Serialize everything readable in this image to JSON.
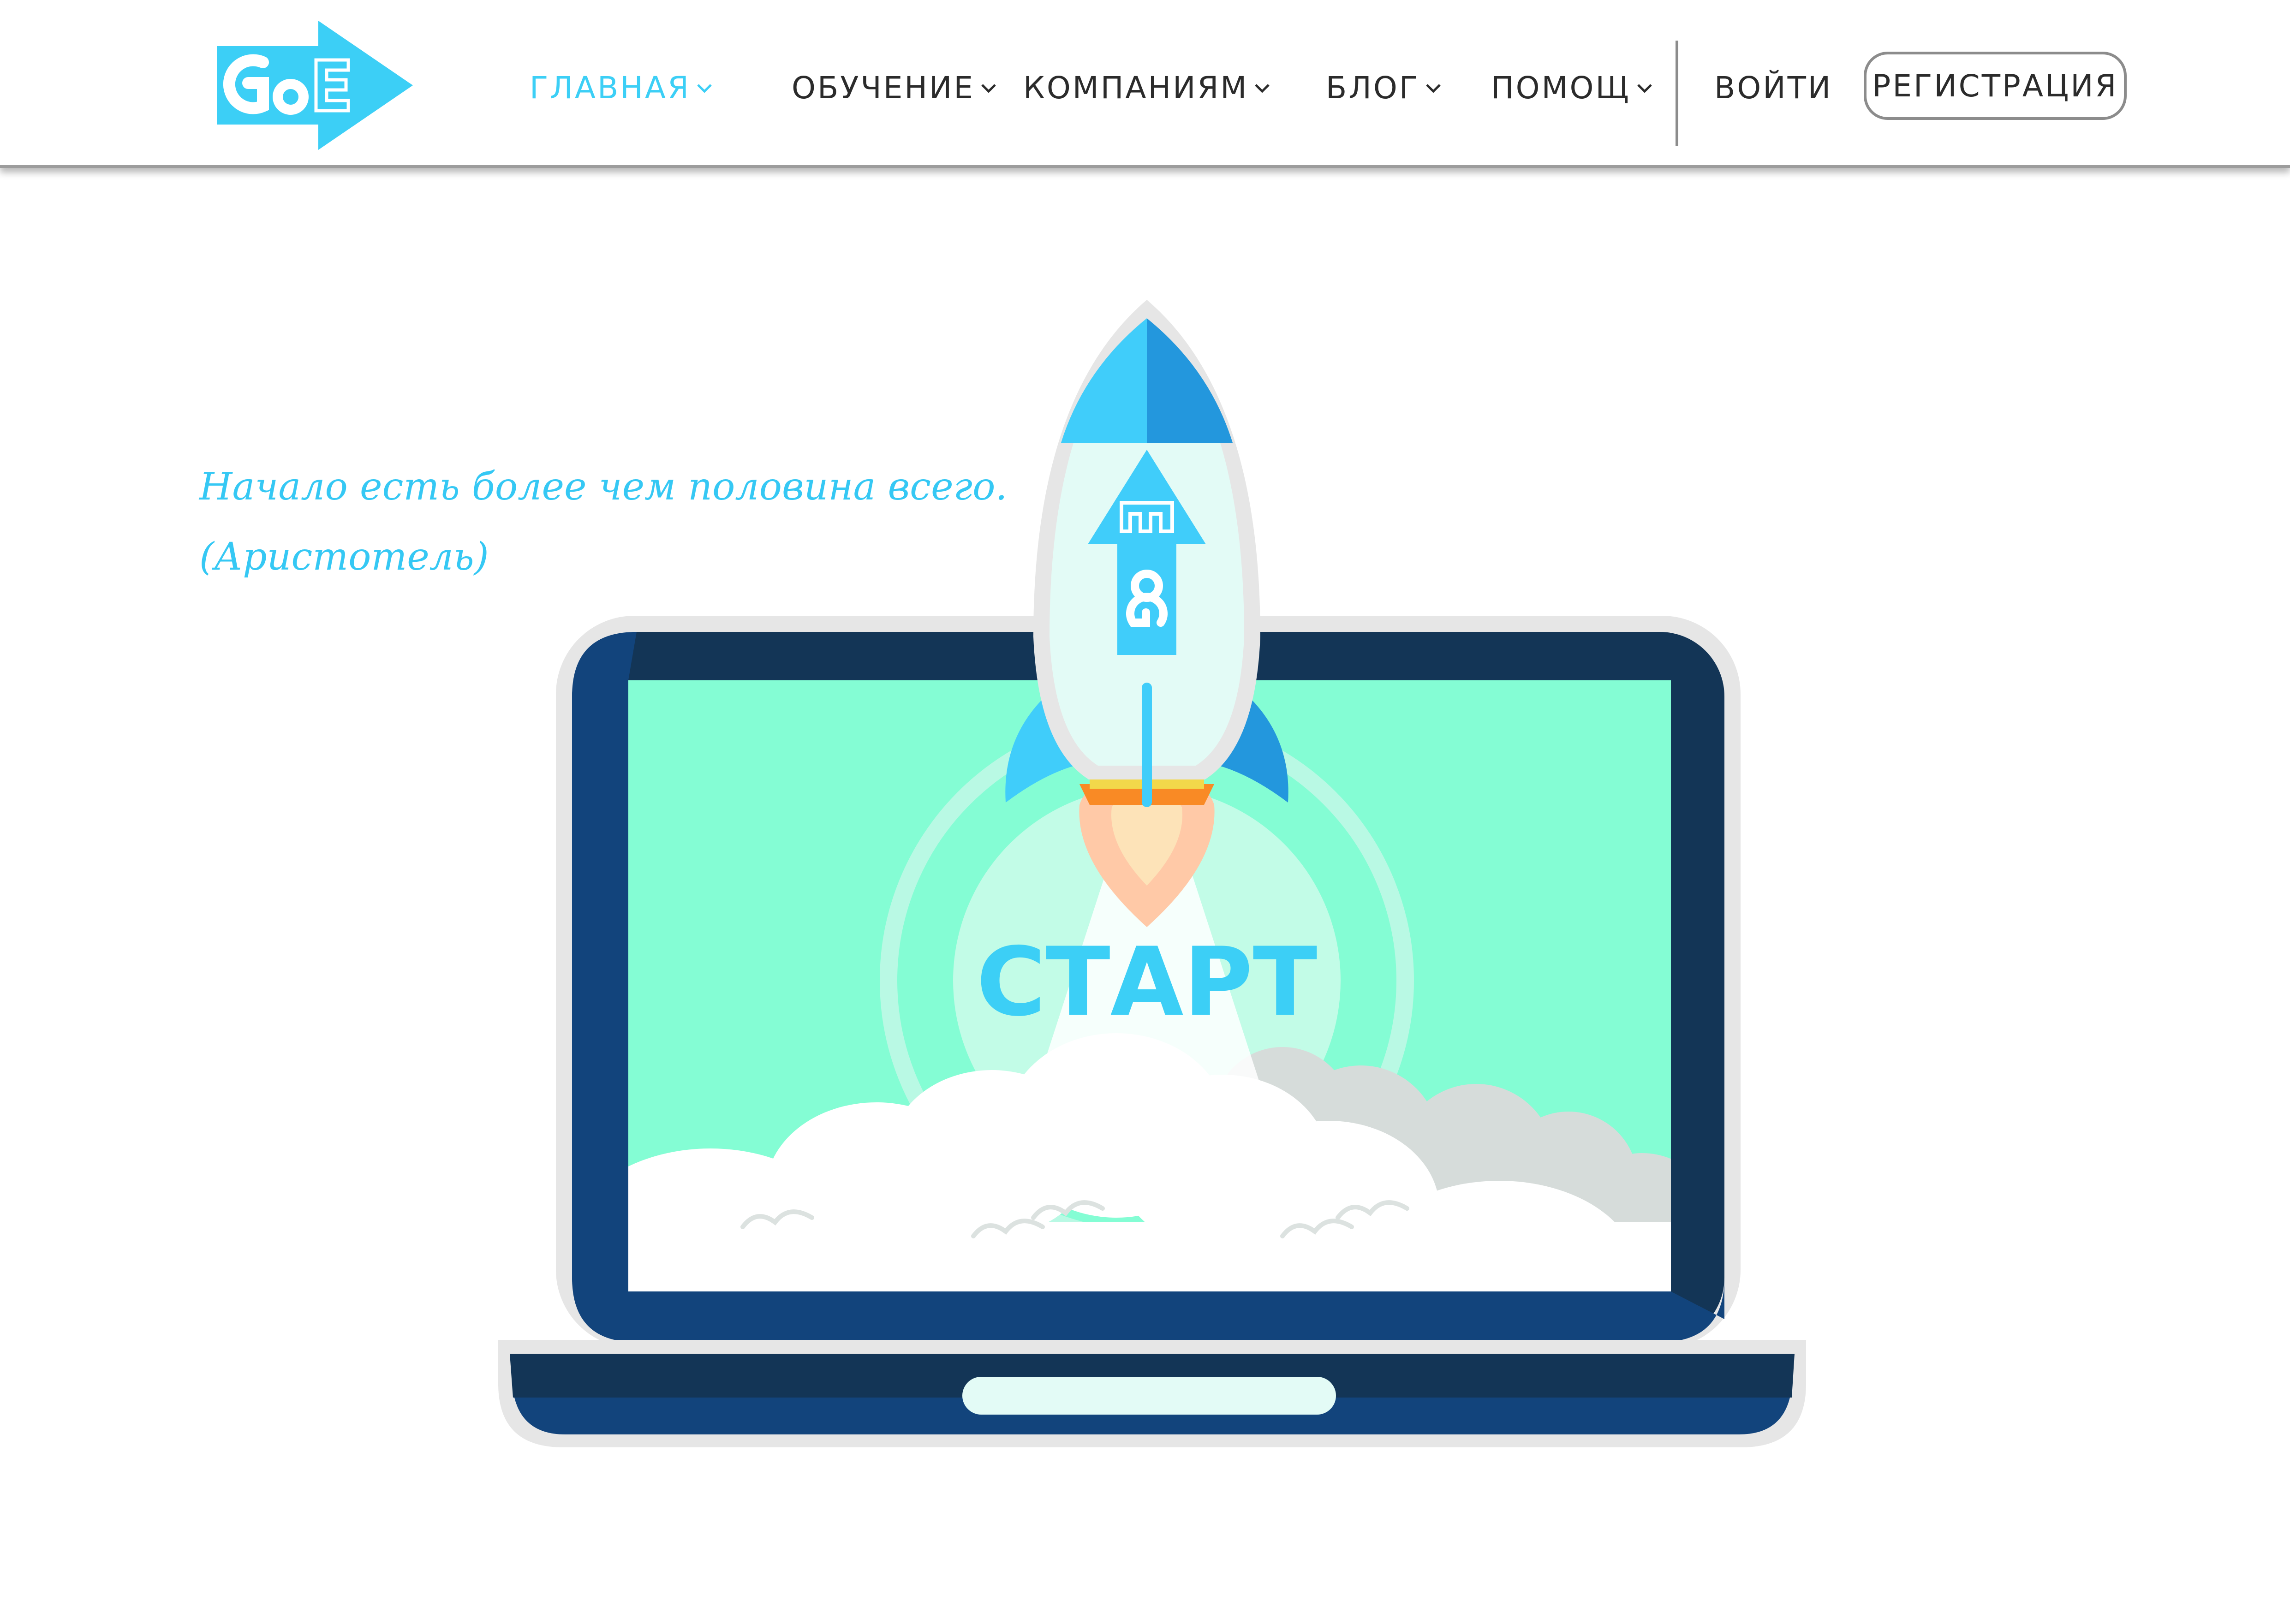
{
  "header": {
    "logo_icon": "goe-arrow-logo",
    "nav": [
      {
        "label": "ГЛАВНАЯ",
        "active": true
      },
      {
        "label": "ОБУЧЕНИЕ",
        "active": false
      },
      {
        "label": "КОМПАНИЯМ",
        "active": false
      },
      {
        "label": "БЛОГ",
        "active": false
      },
      {
        "label": "ПОМОЩ",
        "active": false
      }
    ],
    "login_label": "ВОЙТИ",
    "register_label": "РЕГИСТРАЦИЯ"
  },
  "quote": {
    "line1": "Начало есть более чем половина всего.",
    "line2": "(Аристотель)"
  },
  "hero": {
    "start_label": "СТАРТ",
    "illustration": "rocket-launching-from-laptop"
  },
  "colors": {
    "accent": "#3ccff6",
    "laptop_dark": "#133556",
    "laptop_blue": "#12447c",
    "screen": "#84fdd4",
    "rocket_body": "#e3fbf6",
    "rocket_blue": "#40cdfa",
    "text_dark": "#2b2b2b"
  }
}
